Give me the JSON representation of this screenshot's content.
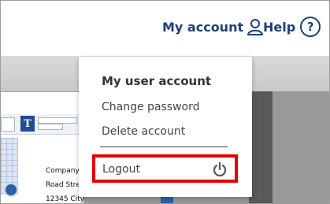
{
  "nav": {
    "my_account": "My account",
    "help": "Help",
    "help_symbol": "?",
    "accent_color": "#1f3f7a"
  },
  "dropdown": {
    "title": "My user account",
    "items": [
      {
        "label": "Change password",
        "icon": ""
      },
      {
        "label": "Delete account",
        "icon": ""
      }
    ],
    "logout": {
      "label": "Logout",
      "icon": "power-icon",
      "highlight_color": "#e60000"
    }
  },
  "preview": {
    "t_symbol": "T",
    "lines": [
      "Company",
      "Road Stre",
      "12345 City"
    ]
  },
  "icons": {
    "account": "user-icon",
    "help": "help-circle-icon"
  }
}
